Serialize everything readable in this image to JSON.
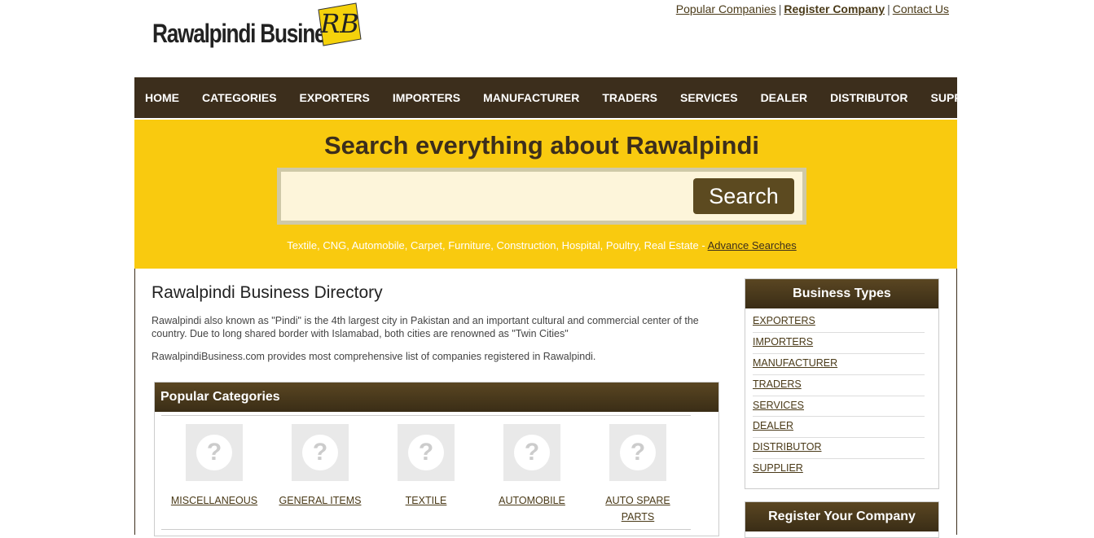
{
  "header": {
    "logo_text": "Rawalpindi Business",
    "logo_badge": "RB",
    "links": [
      "Popular Companies",
      "Register Company",
      "Contact Us"
    ],
    "separator": "|"
  },
  "nav": {
    "items": [
      "HOME",
      "CATEGORIES",
      "EXPORTERS",
      "IMPORTERS",
      "MANUFACTURER",
      "TRADERS",
      "SERVICES",
      "DEALER",
      "DISTRIBUTOR",
      "SUPPLIER"
    ]
  },
  "hero": {
    "title": "Search everything about Rawalpindi",
    "search_value": "",
    "search_button": "Search",
    "suggestions": "Textile, CNG, Automobile, Carpet, Furniture, Construction, Hospital, Poultry, Real Estate -",
    "advance_link": "Advance Searches",
    "bg_color": "#f9ca0f"
  },
  "main": {
    "title": "Rawalpindi Business Directory",
    "para1": "Rawalpindi also known as \"Pindi\" is the 4th largest city in Pakistan and an important cultural and commercial center of the country. Due to long shared border with Islamabad, both cities are renowned as \"Twin Cities\"",
    "para2": "RawalpindiBusiness.com provides most comprehensive list of companies registered in Rawalpindi."
  },
  "popular": {
    "title": "Popular Categories",
    "categories": [
      "MISCELLANEOUS",
      "GENERAL ITEMS",
      "TEXTILE",
      "AUTOMOBILE",
      "AUTO SPARE PARTS"
    ],
    "placeholder_icon": "question-mark-icon"
  },
  "sidebar": {
    "title": "Business Types",
    "items": [
      "EXPORTERS",
      "IMPORTERS",
      "MANUFACTURER",
      "TRADERS",
      "SERVICES",
      "DEALER",
      "DISTRIBUTOR",
      "SUPPLIER"
    ],
    "register_title": "Register Your Company"
  },
  "colors": {
    "brand_dark": "#3c2e1c",
    "brand_yellow": "#f9ca0f",
    "button": "#5c4a20"
  }
}
